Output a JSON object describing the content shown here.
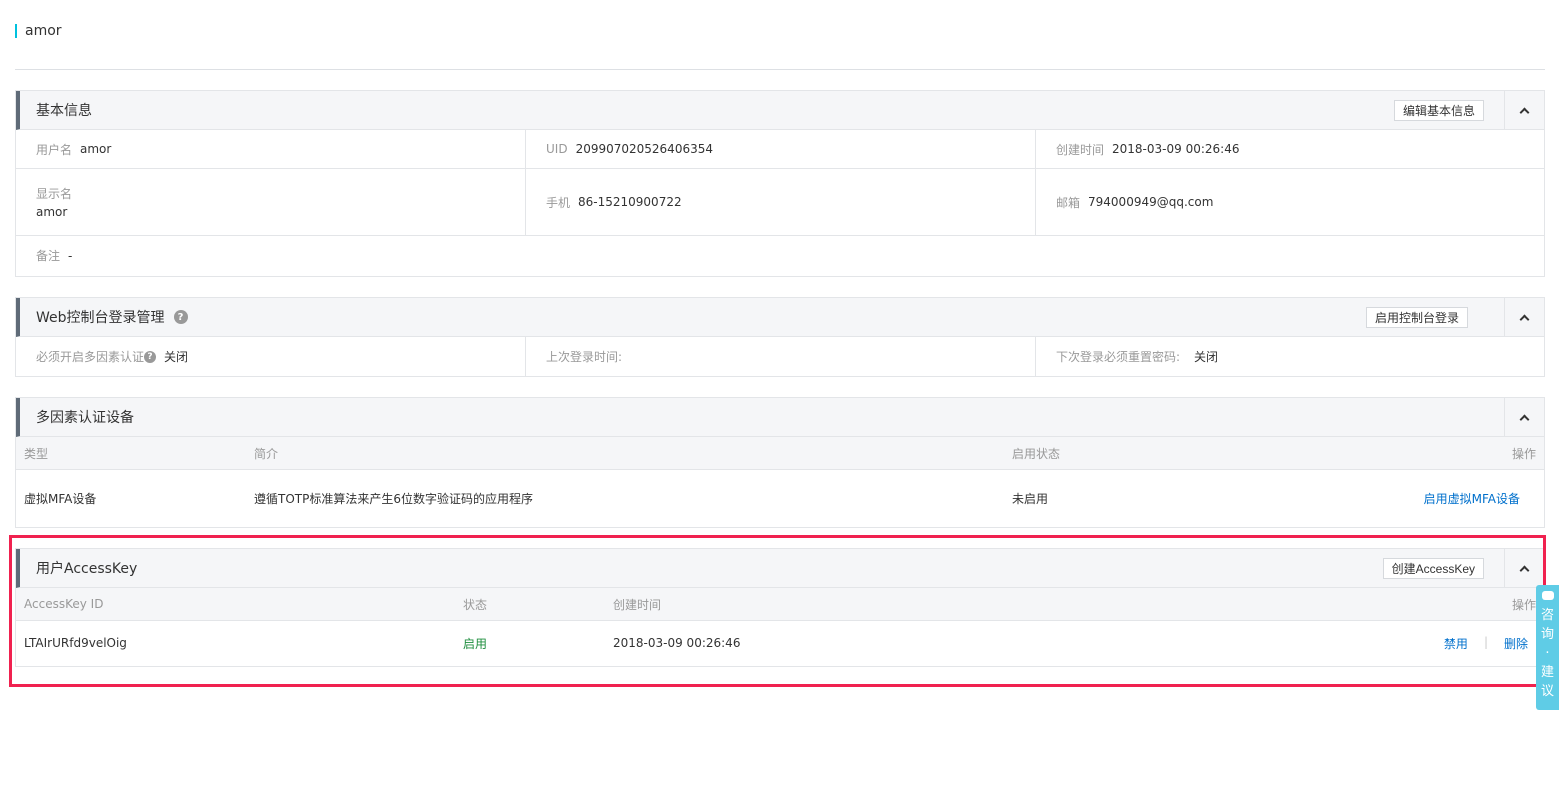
{
  "page": {
    "title": "amor"
  },
  "basic": {
    "title": "基本信息",
    "edit_btn": "编辑基本信息",
    "username_label": "用户名",
    "username": "amor",
    "uid_label": "UID",
    "uid": "209907020526406354",
    "created_label": "创建时间",
    "created": "2018-03-09 00:26:46",
    "display_label": "显示名",
    "display": "amor",
    "phone_label": "手机",
    "phone": "86-15210900722",
    "email_label": "邮箱",
    "email": "794000949@qq.com",
    "note_label": "备注",
    "note": "-"
  },
  "web": {
    "title": "Web控制台登录管理",
    "help": "?",
    "enable_btn": "启用控制台登录",
    "mfa_label": "必须开启多因素认证",
    "mfa_help": "?",
    "mfa_value": "关闭",
    "last_login_label": "上次登录时间:",
    "last_login_value": "",
    "reset_label": "下次登录必须重置密码:",
    "reset_value": "关闭"
  },
  "mfa": {
    "title": "多因素认证设备",
    "headers": {
      "type": "类型",
      "desc": "简介",
      "status": "启用状态",
      "action": "操作"
    },
    "row": {
      "type": "虚拟MFA设备",
      "desc": "遵循TOTP标准算法来产生6位数字验证码的应用程序",
      "status": "未启用",
      "action": "启用虚拟MFA设备"
    }
  },
  "accesskey": {
    "title": "用户AccessKey",
    "create_btn": "创建AccessKey",
    "headers": {
      "id": "AccessKey ID",
      "status": "状态",
      "created": "创建时间",
      "action": "操作"
    },
    "row": {
      "id": "LTAIrURfd9velOig",
      "status": "启用",
      "created": "2018-03-09 00:26:46",
      "disable": "禁用",
      "sep": "|",
      "delete": "删除"
    }
  },
  "side_widget": {
    "chars": [
      "咨",
      "询",
      "·",
      "建",
      "议"
    ]
  },
  "colors": {
    "accent": "#00c1de",
    "link": "#0070cc",
    "highlight": "#f0214f",
    "status_on": "#1e8e3e",
    "widget": "#5fcce6"
  }
}
